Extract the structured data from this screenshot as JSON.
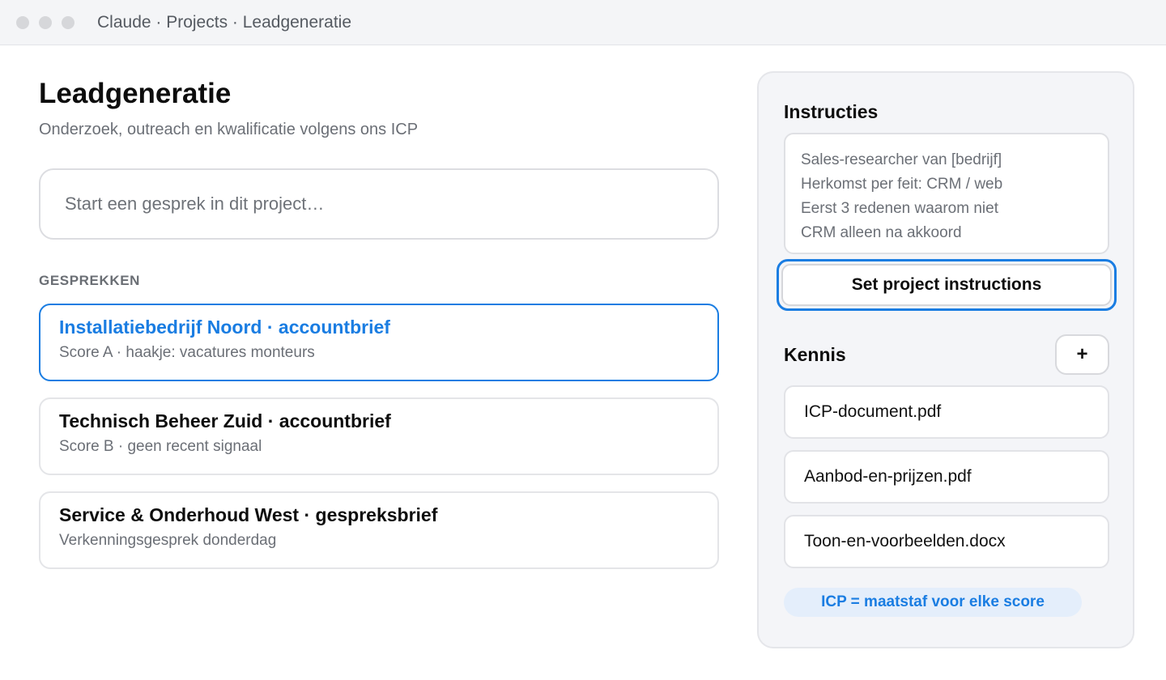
{
  "window": {
    "breadcrumb": "Claude · Projects · Leadgeneratie"
  },
  "project": {
    "title": "Leadgeneratie",
    "subtitle": "Onderzoek, outreach en kwalificatie volgens ons ICP",
    "composer_placeholder": "Start een gesprek in dit project…"
  },
  "conversations": {
    "section_label": "GESPREKKEN",
    "items": [
      {
        "title": "Installatiebedrijf Noord · accountbrief",
        "subtitle": "Score A · haakje: vacatures monteurs",
        "active": true
      },
      {
        "title": "Technisch Beheer Zuid · accountbrief",
        "subtitle": "Score B · geen recent signaal",
        "active": false
      },
      {
        "title": "Service & Onderhoud West · gespreksbrief",
        "subtitle": "Verkenningsgesprek donderdag",
        "active": false
      }
    ]
  },
  "sidebar": {
    "instructions_heading": "Instructies",
    "instructions_lines": [
      "Sales-researcher van [bedrijf]",
      "Herkomst per feit: CRM / web",
      "Eerst 3 redenen waarom niet",
      "CRM alleen na akkoord"
    ],
    "set_button_label": "Set project instructions",
    "knowledge_heading": "Kennis",
    "add_button_label": "+",
    "files": [
      "ICP-document.pdf",
      "Aanbod-en-prijzen.pdf",
      "Toon-en-voorbeelden.docx"
    ],
    "badge": "ICP = maatstaf voor elke score"
  },
  "colors": {
    "accent": "#1a7de2",
    "panel_bg": "#f4f5f8",
    "muted_text": "#6b6f76"
  }
}
